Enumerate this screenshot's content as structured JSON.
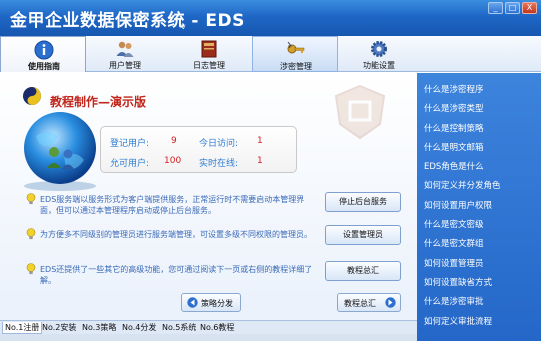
{
  "window": {
    "title": "金甲企业数据保密系统 - EDS",
    "chevron": "v",
    "controls": {
      "minimize": "_",
      "maximize": "□",
      "close": "X"
    }
  },
  "toolbar": {
    "items": [
      {
        "label": "使用指南",
        "icon": "info-icon"
      },
      {
        "label": "用户管理",
        "icon": "users-icon"
      },
      {
        "label": "日志管理",
        "icon": "book-icon"
      },
      {
        "label": "涉密管理",
        "icon": "key-icon"
      },
      {
        "label": "功能设置",
        "icon": "gear-icon"
      }
    ]
  },
  "main": {
    "heading": "教程制作—演示版",
    "stats": {
      "registered_label": "登记用户:",
      "registered_value": "9",
      "today_label": "今日访问:",
      "today_value": "1",
      "allowed_label": "允可用户:",
      "allowed_value": "100",
      "online_label": "实时在线:",
      "online_value": "1"
    },
    "descriptions": [
      "EDS服务端以服务形式为客户端提供服务，正常运行时不需要启动本管理界面，但可以通过本管理程序启动或停止后台服务。",
      "为方便多不同级别的管理员进行服务端管理，可设置多级不同权限的管理员。",
      "EDS还提供了一些其它的高级功能，您可通过阅读下一页或右侧的教程详细了解。"
    ],
    "actions": {
      "stop_service": "停止后台服务",
      "set_admin": "设置管理员",
      "tutorial_summary": "教程总汇"
    },
    "nav": {
      "prev": "策略分发",
      "next": "教程总汇"
    }
  },
  "tabs": [
    "No.1注册",
    "No.2安装",
    "No.3策略",
    "No.4分发",
    "No.5系统",
    "No.6教程"
  ],
  "sidebar": {
    "items": [
      "什么是涉密程序",
      "什么是涉密类型",
      "什么是控制策略",
      "什么是明文邮箱",
      "EDS角色是什么",
      "如何定义并分发角色",
      "如何设置用户权限",
      "什么是密文密级",
      "什么是密文群组",
      "如何设置管理员",
      "如何设置缺省方式",
      "什么是涉密审批",
      "如何定义审批流程"
    ]
  },
  "colors": {
    "titlebar": "#1f67c6",
    "sidebar": "#2d6fcf",
    "heading": "#c0261b",
    "stat_label": "#2d7bd3",
    "stat_value": "#d61f1f",
    "description": "#3a6ab8"
  }
}
